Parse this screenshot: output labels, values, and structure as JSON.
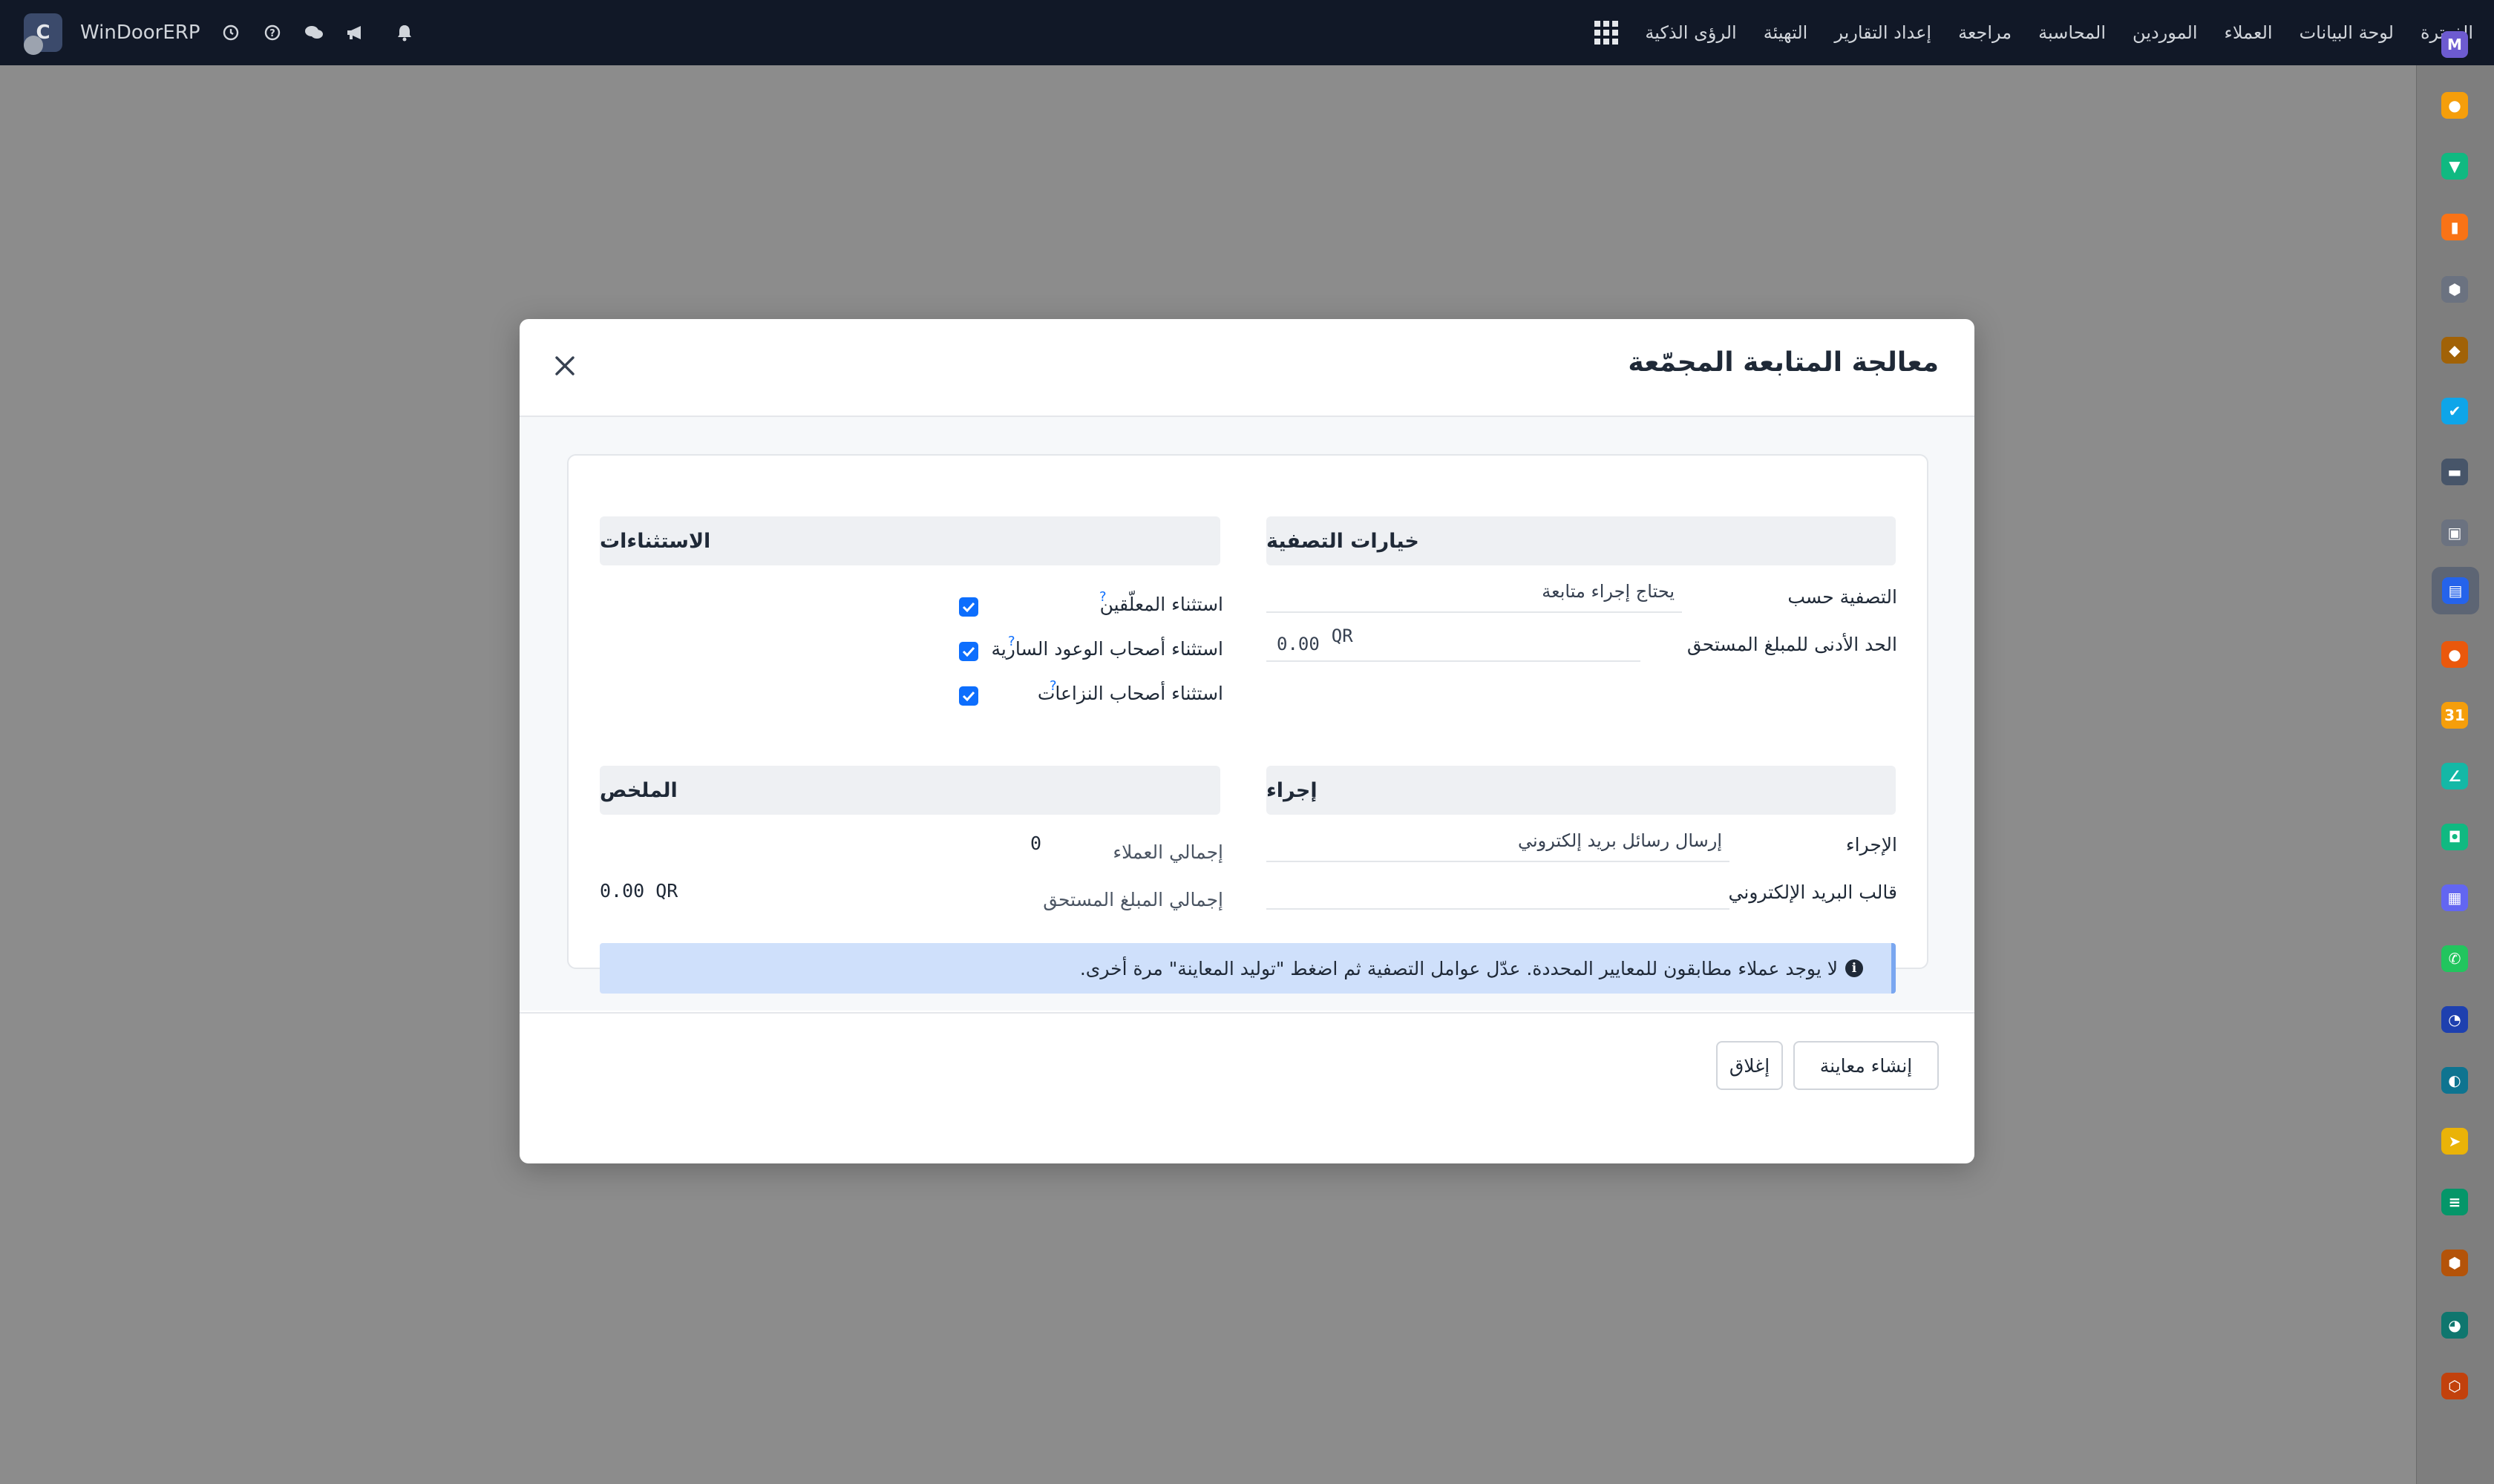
{
  "navbar": {
    "brand": "WinDoorERP",
    "logo_letter": "C",
    "menu": [
      {
        "label": "الفوترة"
      },
      {
        "label": "لوحة البيانات"
      },
      {
        "label": "العملاء"
      },
      {
        "label": "الموردين"
      },
      {
        "label": "المحاسبة"
      },
      {
        "label": "مراجعة"
      },
      {
        "label": "إعداد التقارير"
      },
      {
        "label": "التهيئة"
      },
      {
        "label": "الرؤى الذكية"
      }
    ],
    "icons": [
      "clock-icon",
      "help-icon",
      "chat-icon",
      "megaphone-icon",
      "bell-icon",
      "apps-grid-icon"
    ]
  },
  "sidebar": {
    "apps": [
      {
        "icon": "mail-icon",
        "color": "#6d5bd0",
        "glyph": "M"
      },
      {
        "icon": "discuss-icon",
        "color": "#f59e0b",
        "glyph": "●"
      },
      {
        "icon": "inbox-icon",
        "color": "#10b981",
        "glyph": "▼"
      },
      {
        "icon": "bar-chart-icon",
        "color": "#f97316",
        "glyph": "▮"
      },
      {
        "icon": "cube-icon",
        "color": "#6b7280",
        "glyph": "⬢"
      },
      {
        "icon": "contacts-icon",
        "color": "#a16207",
        "glyph": "◆"
      },
      {
        "icon": "checkmark-icon",
        "color": "#0ea5e9",
        "glyph": "✔"
      },
      {
        "icon": "helpdesk-icon",
        "color": "#475569",
        "glyph": "▬"
      },
      {
        "icon": "box-icon",
        "color": "#6b7280",
        "glyph": "▣"
      },
      {
        "icon": "documents-icon",
        "color": "#2563eb",
        "glyph": "▤"
      },
      {
        "icon": "team-icon",
        "color": "#ea580c",
        "glyph": "●"
      },
      {
        "icon": "calendar-icon",
        "color": "#f59e0b",
        "glyph": "31"
      },
      {
        "icon": "sign-icon",
        "color": "#14b8a6",
        "glyph": "∠"
      },
      {
        "icon": "employee-icon",
        "color": "#10b981",
        "glyph": "◘"
      },
      {
        "icon": "dashboard-icon",
        "color": "#6366f1",
        "glyph": "▦"
      },
      {
        "icon": "whatsapp-icon",
        "color": "#22c55e",
        "glyph": "✆"
      },
      {
        "icon": "timer-icon",
        "color": "#1e40af",
        "glyph": "◔"
      },
      {
        "icon": "globe-icon",
        "color": "#0e7490",
        "glyph": "◐"
      },
      {
        "icon": "send-icon",
        "color": "#eab308",
        "glyph": "➤"
      },
      {
        "icon": "list-icon",
        "color": "#059669",
        "glyph": "≡"
      },
      {
        "icon": "hexagon-icon",
        "color": "#b45309",
        "glyph": "⬢"
      },
      {
        "icon": "pie-icon",
        "color": "#0f766e",
        "glyph": "◕"
      },
      {
        "icon": "hex-outline-icon",
        "color": "#c2410c",
        "glyph": "⬡"
      }
    ]
  },
  "modal": {
    "title": "معالجة المتابعة المجمّعة",
    "filter": {
      "heading": "خيارات التصفية",
      "filter_by_label": "التصفية حسب",
      "filter_by_value": "يحتاج إجراء متابعة",
      "min_amount_label": "الحد الأدنى للمبلغ المستحق",
      "min_amount_currency": "QR",
      "min_amount_value": "0.00"
    },
    "exclusions": {
      "heading": "الاستثناءات",
      "items": [
        {
          "label": "استثناء المعلّقين",
          "help": "?",
          "checked": true
        },
        {
          "label": "استثناء أصحاب الوعود السارية",
          "help": "?",
          "checked": true
        },
        {
          "label": "استثناء أصحاب النزاعات",
          "help": "?",
          "checked": true
        }
      ]
    },
    "action": {
      "heading": "إجراء",
      "action_label": "الإجراء",
      "action_value": "إرسال رسائل بريد إلكتروني",
      "template_label": "قالب البريد الإلكتروني",
      "template_value": ""
    },
    "summary": {
      "heading": "الملخص",
      "total_customers_label": "إجمالي العملاء",
      "total_customers_value": "0",
      "total_due_label": "إجمالي المبلغ المستحق",
      "total_due_value": "0.00 QR"
    },
    "alert": "لا يوجد عملاء مطابقون للمعايير المحددة. عدّل عوامل التصفية ثم اضغط \"توليد المعاينة\" مرة أخرى.",
    "buttons": {
      "preview": "إنشاء معاينة",
      "close": "إغلاق"
    }
  }
}
